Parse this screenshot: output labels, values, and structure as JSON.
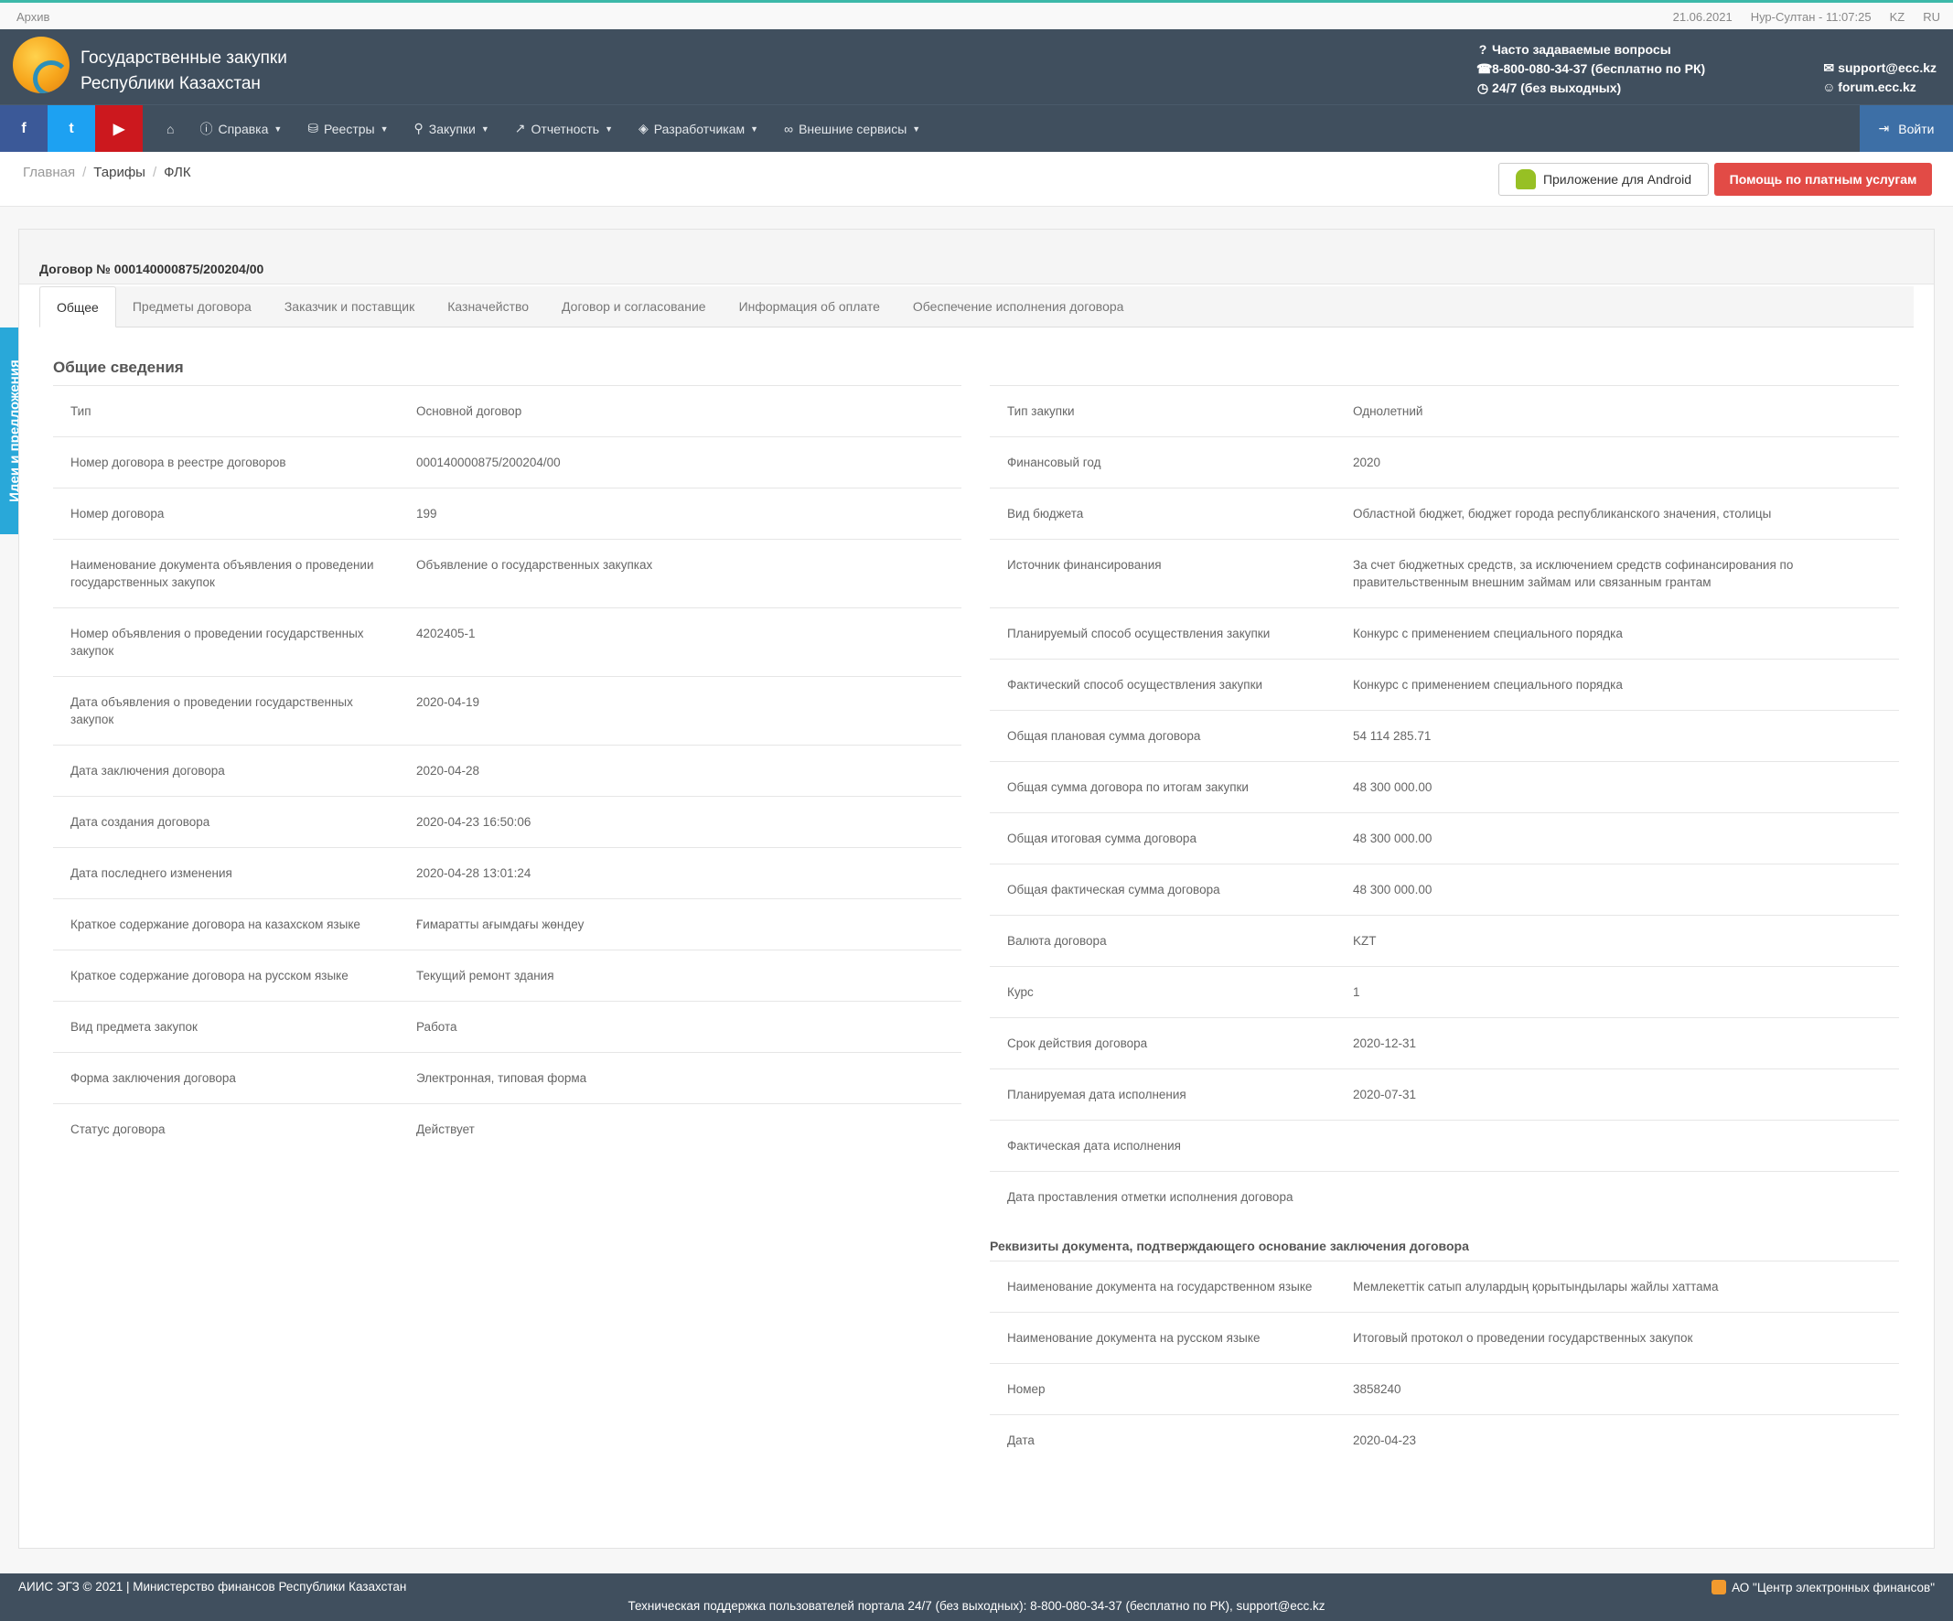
{
  "topbar": {
    "archive": "Архив",
    "date": "21.06.2021",
    "city_time": "Нур-Султан - 11:07:25",
    "lang_kz": "KZ",
    "lang_ru": "RU"
  },
  "header": {
    "title_line1": "Государственные закупки",
    "title_line2": "Республики Казахстан",
    "faq": "Часто задаваемые вопросы",
    "phone": "8-800-080-34-37 (бесплатно по РК)",
    "hours": "24/7 (без выходных)",
    "email": "support@ecc.kz",
    "forum": "forum.ecc.kz"
  },
  "nav": {
    "facebook": "f",
    "twitter": "t",
    "youtube": "▶",
    "items": [
      {
        "label": "Справка",
        "icon": "help-circle-icon"
      },
      {
        "label": "Реестры",
        "icon": "database-icon"
      },
      {
        "label": "Закупки",
        "icon": "search-icon"
      },
      {
        "label": "Отчетность",
        "icon": "chart-line-icon"
      },
      {
        "label": "Разработчикам",
        "icon": "tag-icon"
      },
      {
        "label": "Внешние сервисы",
        "icon": "link-icon"
      }
    ],
    "login": "Войти"
  },
  "breadcrumb": [
    "Главная",
    "Тарифы",
    "ФЛК"
  ],
  "buttons": {
    "android": "Приложение для Android",
    "paid_help": "Помощь по платным услугам"
  },
  "side_tab": "Идеи и предложения",
  "contract": {
    "title": "Договор № 000140000875/200204/00",
    "tabs": [
      "Общее",
      "Предметы договора",
      "Заказчик и поставщик",
      "Казначейство",
      "Договор и согласование",
      "Информация об оплате",
      "Обеспечение исполнения договора"
    ],
    "section_title": "Общие сведения",
    "left_rows": [
      {
        "k": "Тип",
        "v": "Основной договор"
      },
      {
        "k": "Номер договора в реестре договоров",
        "v": "000140000875/200204/00"
      },
      {
        "k": "Номер договора",
        "v": "199"
      },
      {
        "k": "Наименование документа объявления о проведении государственных закупок",
        "v": "Объявление о государственных закупках"
      },
      {
        "k": "Номер объявления о проведении государственных закупок",
        "v": "4202405-1"
      },
      {
        "k": "Дата объявления о проведении государственных закупок",
        "v": "2020-04-19"
      },
      {
        "k": "Дата заключения договора",
        "v": "2020-04-28"
      },
      {
        "k": "Дата создания договора",
        "v": "2020-04-23 16:50:06"
      },
      {
        "k": "Дата последнего изменения",
        "v": "2020-04-28 13:01:24"
      },
      {
        "k": "Краткое содержание договора на казахском языке",
        "v": "Ғимаратты ағымдағы жөндеу"
      },
      {
        "k": "Краткое содержание договора на русском языке",
        "v": "Текущий ремонт здания"
      },
      {
        "k": "Вид предмета закупок",
        "v": "Работа"
      },
      {
        "k": "Форма заключения договора",
        "v": "Электронная, типовая форма"
      },
      {
        "k": "Статус договора",
        "v": "Действует"
      }
    ],
    "right_rows": [
      {
        "k": "Тип закупки",
        "v": "Однолетний"
      },
      {
        "k": "Финансовый год",
        "v": "2020"
      },
      {
        "k": "Вид бюджета",
        "v": "Областной бюджет, бюджет города республиканского значения, столицы"
      },
      {
        "k": "Источник финансирования",
        "v": "За счет бюджетных средств, за исключением средств софинансирования по правительственным внешним займам или связанным грантам"
      },
      {
        "k": "Планируемый способ осуществления закупки",
        "v": "Конкурс с применением специального порядка"
      },
      {
        "k": "Фактический способ осуществления закупки",
        "v": "Конкурс с применением специального порядка"
      },
      {
        "k": "Общая плановая сумма договора",
        "v": "54 114 285.71"
      },
      {
        "k": "Общая сумма договора по итогам закупки",
        "v": "48 300 000.00"
      },
      {
        "k": "Общая итоговая сумма договора",
        "v": "48 300 000.00"
      },
      {
        "k": "Общая фактическая сумма договора",
        "v": "48 300 000.00"
      },
      {
        "k": "Валюта договора",
        "v": "KZT"
      },
      {
        "k": "Курс",
        "v": "1"
      },
      {
        "k": "Срок действия договора",
        "v": "2020-12-31"
      },
      {
        "k": "Планируемая дата исполнения",
        "v": "2020-07-31"
      },
      {
        "k": "Фактическая дата исполнения",
        "v": ""
      },
      {
        "k": "Дата проставления отметки исполнения договора",
        "v": ""
      }
    ],
    "requisites_title": "Реквизиты документа, подтверждающего основание заключения договора",
    "requisites_rows": [
      {
        "k": "Наименование документа на государственном языке",
        "v": "Мемлекеттік сатып алулардың қорытындылары жайлы хаттама"
      },
      {
        "k": "Наименование документа на русском языке",
        "v": "Итоговый протокол о проведении государственных закупок"
      },
      {
        "k": "Номер",
        "v": "3858240"
      },
      {
        "k": "Дата",
        "v": "2020-04-23"
      }
    ]
  },
  "footer": {
    "left": "АИИС ЭГЗ © 2021 | Министерство финансов Республики Казахстан",
    "right": "АО \"Центр электронных финансов\"",
    "center": "Техническая поддержка пользователей портала 24/7 (без выходных): 8-800-080-34-37 (бесплатно по РК), support@ecc.kz"
  },
  "colors": {
    "header_bg": "#404f5e",
    "accent_red": "#e24b46",
    "side_tab": "#29a8d9",
    "login_bg": "#3d6fa6"
  }
}
